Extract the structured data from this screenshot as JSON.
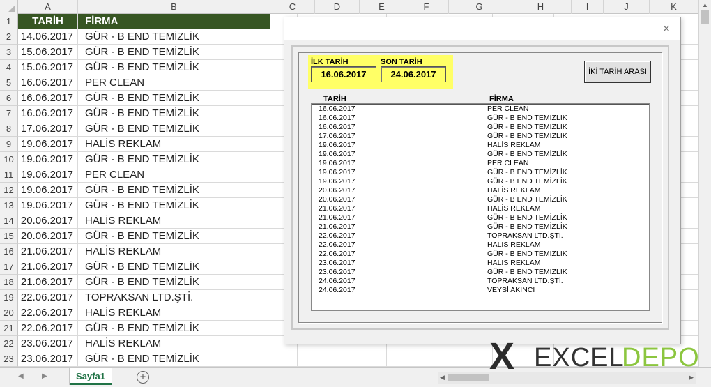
{
  "columns": [
    "A",
    "B",
    "C",
    "D",
    "E",
    "F",
    "G",
    "H",
    "I",
    "J",
    "K"
  ],
  "sheet": {
    "headers": {
      "tarih": "TARİH",
      "firma": "FİRMA"
    },
    "rows": [
      {
        "tarih": "14.06.2017",
        "firma": "GÜR - B END TEMİZLİK"
      },
      {
        "tarih": "15.06.2017",
        "firma": "GÜR - B END TEMİZLİK"
      },
      {
        "tarih": "15.06.2017",
        "firma": "GÜR - B END TEMİZLİK"
      },
      {
        "tarih": "16.06.2017",
        "firma": "PER CLEAN"
      },
      {
        "tarih": "16.06.2017",
        "firma": "GÜR - B END TEMİZLİK"
      },
      {
        "tarih": "16.06.2017",
        "firma": "GÜR - B END TEMİZLİK"
      },
      {
        "tarih": "17.06.2017",
        "firma": "GÜR - B END TEMİZLİK"
      },
      {
        "tarih": "19.06.2017",
        "firma": "HALİS REKLAM"
      },
      {
        "tarih": "19.06.2017",
        "firma": "GÜR - B END TEMİZLİK"
      },
      {
        "tarih": "19.06.2017",
        "firma": "PER CLEAN"
      },
      {
        "tarih": "19.06.2017",
        "firma": "GÜR - B END TEMİZLİK"
      },
      {
        "tarih": "19.06.2017",
        "firma": "GÜR - B END TEMİZLİK"
      },
      {
        "tarih": "20.06.2017",
        "firma": "HALİS REKLAM"
      },
      {
        "tarih": "20.06.2017",
        "firma": "GÜR - B END TEMİZLİK"
      },
      {
        "tarih": "21.06.2017",
        "firma": "HALİS REKLAM"
      },
      {
        "tarih": "21.06.2017",
        "firma": "GÜR - B END TEMİZLİK"
      },
      {
        "tarih": "21.06.2017",
        "firma": "GÜR - B END TEMİZLİK"
      },
      {
        "tarih": "22.06.2017",
        "firma": "TOPRAKSAN LTD.ŞTİ."
      },
      {
        "tarih": "22.06.2017",
        "firma": "HALİS REKLAM"
      },
      {
        "tarih": "22.06.2017",
        "firma": "GÜR - B END TEMİZLİK"
      },
      {
        "tarih": "23.06.2017",
        "firma": "HALİS REKLAM"
      },
      {
        "tarih": "23.06.2017",
        "firma": "GÜR - B END TEMİZLİK"
      }
    ]
  },
  "tab": {
    "label": "Sayfa1",
    "add_icon": "plus-circle-icon"
  },
  "dialog": {
    "close_label": "×",
    "ilk_tarih_label": "İLK TARİH",
    "ilk_tarih_value": "16.06.2017",
    "son_tarih_label": "SON TARİH",
    "son_tarih_value": "24.06.2017",
    "button_label": "İKİ TARİH ARASI",
    "list_header_tarih": "TARİH",
    "list_header_firma": "FİRMA",
    "list": [
      {
        "tarih": "16.06.2017",
        "firma": "PER CLEAN"
      },
      {
        "tarih": "16.06.2017",
        "firma": "GÜR - B END TEMİZLİK"
      },
      {
        "tarih": "16.06.2017",
        "firma": "GÜR - B END TEMİZLİK"
      },
      {
        "tarih": "17.06.2017",
        "firma": "GÜR - B END TEMİZLİK"
      },
      {
        "tarih": "19.06.2017",
        "firma": "HALİS REKLAM"
      },
      {
        "tarih": "19.06.2017",
        "firma": "GÜR - B END TEMİZLİK"
      },
      {
        "tarih": "19.06.2017",
        "firma": "PER CLEAN"
      },
      {
        "tarih": "19.06.2017",
        "firma": "GÜR - B END TEMİZLİK"
      },
      {
        "tarih": "19.06.2017",
        "firma": "GÜR - B END TEMİZLİK"
      },
      {
        "tarih": "20.06.2017",
        "firma": "HALİS REKLAM"
      },
      {
        "tarih": "20.06.2017",
        "firma": "GÜR - B END TEMİZLİK"
      },
      {
        "tarih": "21.06.2017",
        "firma": "HALİS REKLAM"
      },
      {
        "tarih": "21.06.2017",
        "firma": "GÜR - B END TEMİZLİK"
      },
      {
        "tarih": "21.06.2017",
        "firma": "GÜR - B END TEMİZLİK"
      },
      {
        "tarih": "22.06.2017",
        "firma": "TOPRAKSAN LTD.ŞTİ."
      },
      {
        "tarih": "22.06.2017",
        "firma": "HALİS REKLAM"
      },
      {
        "tarih": "22.06.2017",
        "firma": "GÜR - B END TEMİZLİK"
      },
      {
        "tarih": "23.06.2017",
        "firma": "HALİS REKLAM"
      },
      {
        "tarih": "23.06.2017",
        "firma": "GÜR - B END TEMİZLİK"
      },
      {
        "tarih": "24.06.2017",
        "firma": "TOPRAKSAN LTD.ŞTİ."
      },
      {
        "tarih": "24.06.2017",
        "firma": "VEYSİ AKINCI"
      }
    ]
  },
  "logo": {
    "mark": "X",
    "text1": "EXCEL",
    "text2": "DEPO"
  },
  "colors": {
    "header_green": "#375623",
    "highlight_yellow": "#ffff66",
    "logo_green": "#8cc63f"
  }
}
